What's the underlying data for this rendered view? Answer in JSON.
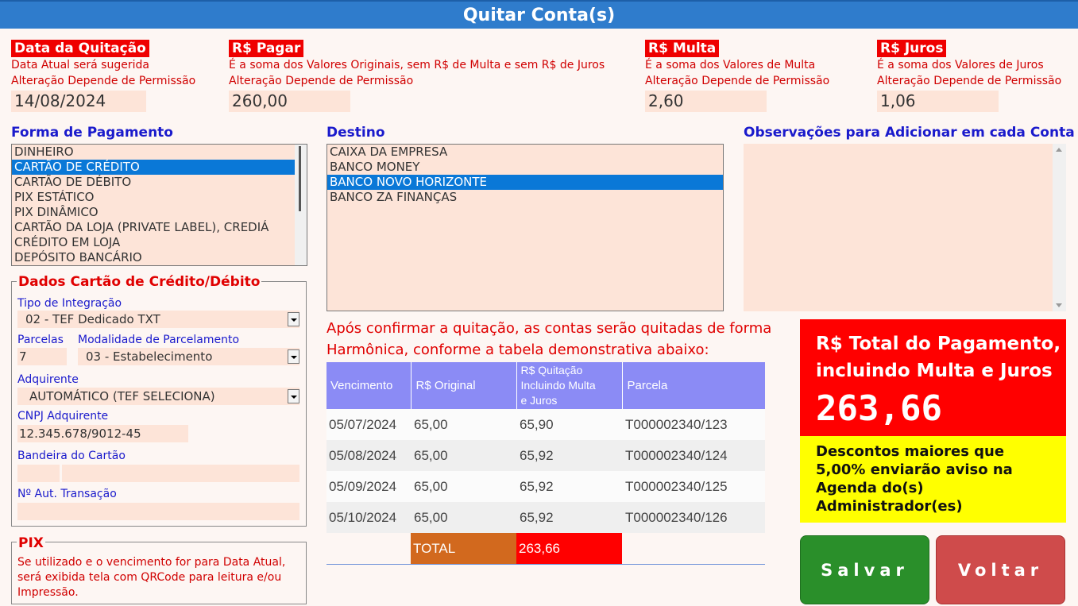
{
  "window": {
    "title": "Quitar Conta(s)"
  },
  "header_fields": [
    {
      "label": "Data da Quitação",
      "hint1": "Data Atual será sugerida",
      "hint2": "Alteração Depende de Permissão",
      "value": "14/08/2024"
    },
    {
      "label": "R$ Pagar",
      "hint1": "É a soma dos Valores Originais, sem R$ de Multa e sem R$ de Juros",
      "hint2": "Alteração Depende de Permissão",
      "value": "260,00"
    },
    {
      "label": "R$ Multa",
      "hint1": "É a soma dos Valores de Multa",
      "hint2": "Alteração Depende de Permissão",
      "value": "2,60"
    },
    {
      "label": "R$ Juros",
      "hint1": "É a soma dos Valores de Juros",
      "hint2": "Alteração Depende de Permissão",
      "value": "1,06"
    }
  ],
  "payment_form": {
    "label": "Forma de Pagamento",
    "items": [
      "DINHEIRO",
      "CARTÃO DE CRÉDITO",
      "CARTÃO DE DÉBITO",
      "PIX ESTÁTICO",
      "PIX DINÂMICO",
      "CARTÃO DA LOJA (PRIVATE LABEL), CREDIÁ",
      "CRÉDITO EM LOJA",
      "DEPÓSITO BANCÁRIO"
    ],
    "selected": "CARTÃO DE CRÉDITO"
  },
  "destination": {
    "label": "Destino",
    "items": [
      "CAIXA DA EMPRESA",
      "BANCO MONEY",
      "BANCO NOVO HORIZONTE",
      "BANCO ZA FINANÇAS"
    ],
    "selected": "BANCO NOVO HORIZONTE"
  },
  "observations": {
    "label": "Observações para Adicionar em cada Conta",
    "value": ""
  },
  "card_data": {
    "legend": "Dados Cartão de Crédito/Débito",
    "integration_label": "Tipo de Integração",
    "integration_value": "02 - TEF Dedicado TXT",
    "installments_label": "Parcelas",
    "installments_value": "7",
    "modality_label": "Modalidade de Parcelamento",
    "modality_value": "03 - Estabelecimento",
    "acquirer_label": "Adquirente",
    "acquirer_value": "AUTOMÁTICO (TEF SELECIONA)",
    "cnpj_label": "CNPJ Adquirente",
    "cnpj_value": "12.345.678/9012-45",
    "brand_label": "Bandeira do Cartão",
    "brand_value": "",
    "auth_label": "Nº Aut. Transação",
    "auth_value": ""
  },
  "pix": {
    "legend": "PIX",
    "line1": "Se utilizado e o vencimento for para Data Atual,",
    "line2": "será exibida tela com QRCode para leitura e/ou",
    "line3": "Impressão."
  },
  "info": {
    "line1": "Após confirmar a quitação, as contas serão quitadas de forma",
    "line2": "Harmônica, conforme a tabela demonstrativa abaixo:"
  },
  "table": {
    "headers": [
      "Vencimento",
      "R$ Original",
      "R$ Quitação Incluindo Multa e Juros",
      "Parcela"
    ],
    "header_q1": "R$ Quitação",
    "header_q2": "Incluindo Multa",
    "header_q3": "e Juros",
    "rows": [
      [
        "05/07/2024",
        "65,00",
        "65,90",
        "T000002340/123"
      ],
      [
        "05/08/2024",
        "65,00",
        "65,92",
        "T000002340/124"
      ],
      [
        "05/09/2024",
        "65,00",
        "65,92",
        "T000002340/125"
      ],
      [
        "05/10/2024",
        "65,00",
        "65,92",
        "T000002340/126"
      ]
    ],
    "total_label": "TOTAL",
    "total_value": "263,66"
  },
  "total_panel": {
    "line1": "R$ Total do Pagamento,",
    "line2": "incluindo Multa e Juros",
    "value": "263,66"
  },
  "warning": {
    "line1": "Descontos maiores que",
    "line2": "5,00% enviarão aviso na",
    "line3": "Agenda do(s)",
    "line4": "Administrador(es)"
  },
  "buttons": {
    "save": "Salvar",
    "back": "Voltar"
  },
  "colors": {
    "title_bar": "#2f7ccc",
    "accent_red": "#ff0000",
    "selection": "#0a78d7",
    "save": "#2a8f2a",
    "back": "#cf4b4b",
    "warning": "#ffff00",
    "table_header": "#8b8bf5",
    "total_label": "#d2691e"
  }
}
